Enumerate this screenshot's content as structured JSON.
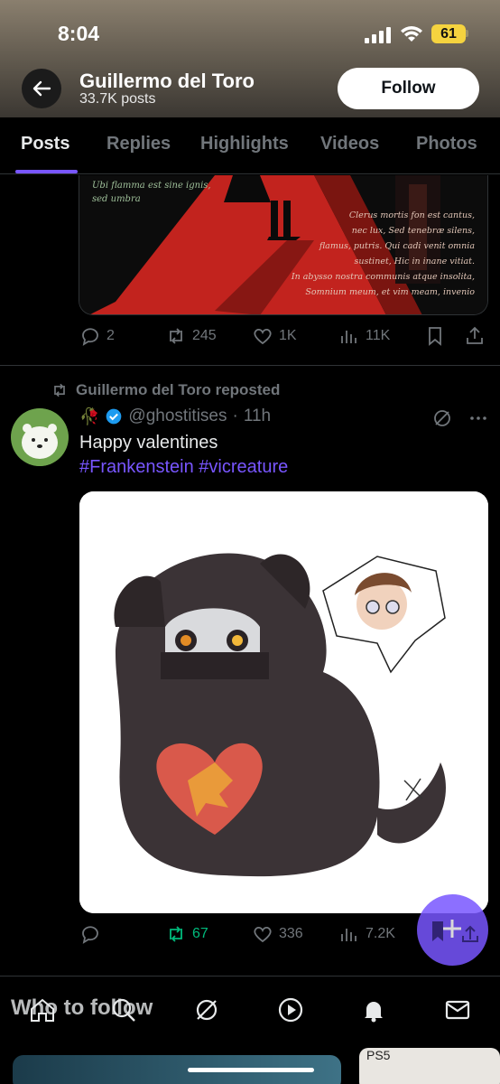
{
  "status_bar": {
    "time": "8:04",
    "battery": "61"
  },
  "header": {
    "name": "Guillermo del Toro",
    "posts_count": "33.7K posts",
    "follow_label": "Follow"
  },
  "tabs": [
    {
      "label": "Posts"
    },
    {
      "label": "Replies"
    },
    {
      "label": "Highlights"
    },
    {
      "label": "Videos"
    },
    {
      "label": "Photos"
    }
  ],
  "post1": {
    "image_text": [
      "Ubi flamma est sine ignis,",
      "sed umbra",
      "Clerus mortis fon est cantus,",
      "nec lux, Sed tenebræ silens,",
      "flamus, putris. Qui cadi venit omnia",
      "sustinet, Hic in inane vitiat.",
      "In abysso nostra communis atque insolita,",
      "Somnium meum, et vim meam, invenio"
    ],
    "replies": "2",
    "reposts": "245",
    "likes": "1K",
    "views": "11K"
  },
  "post2": {
    "repost_label": "Guillermo del Toro reposted",
    "handle": "@ghostitises",
    "time": "11h",
    "text": "Happy valentines",
    "hashtags": "#Frankenstein #vicreature",
    "replies": "",
    "reposts": "67",
    "likes": "336",
    "views": "7.2K"
  },
  "bottom": {
    "who_to_follow": "Who to follow",
    "peek_text": "PS5"
  },
  "colors": {
    "accent": "#7856ff",
    "repost_active": "#00ba7c",
    "muted": "#71767b"
  }
}
